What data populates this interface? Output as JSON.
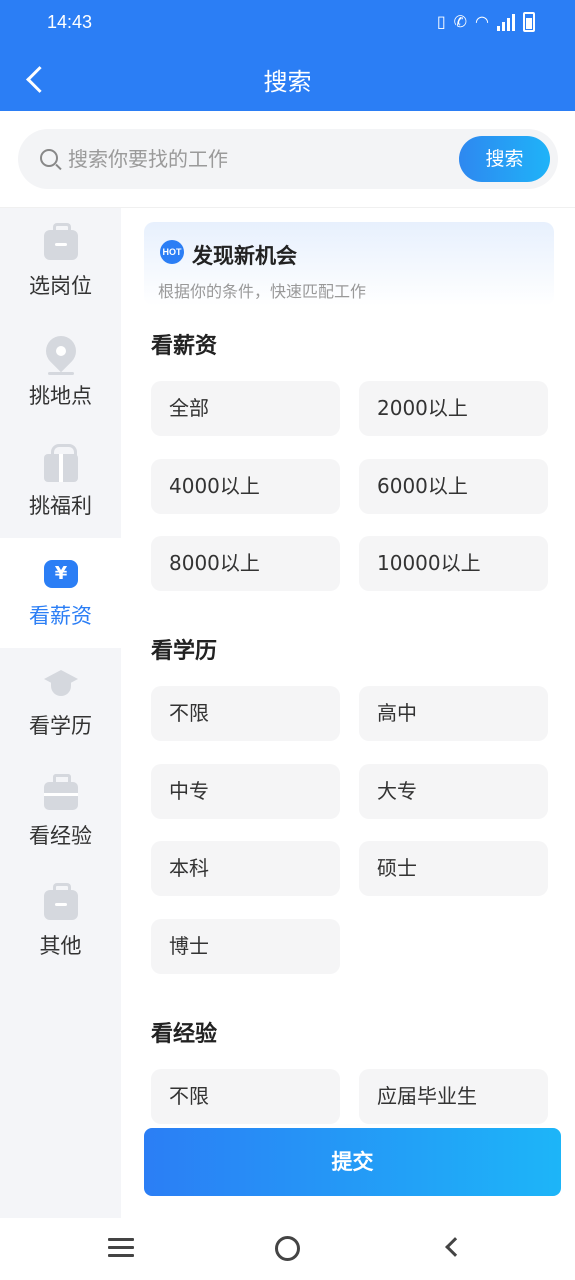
{
  "status_bar": {
    "time": "14:43"
  },
  "navbar": {
    "title": "搜索"
  },
  "search": {
    "placeholder": "搜索你要找的工作",
    "button": "搜索"
  },
  "sidebar": {
    "items": [
      {
        "label": "选岗位",
        "icon": "briefcase-icon",
        "active": false
      },
      {
        "label": "挑地点",
        "icon": "location-pin-icon",
        "active": false
      },
      {
        "label": "挑福利",
        "icon": "gift-icon",
        "active": false
      },
      {
        "label": "看薪资",
        "icon": "yen-icon",
        "active": true
      },
      {
        "label": "看学历",
        "icon": "graduation-cap-icon",
        "active": false
      },
      {
        "label": "看经验",
        "icon": "toolbox-icon",
        "active": false
      },
      {
        "label": "其他",
        "icon": "briefcase-icon",
        "active": false
      }
    ]
  },
  "promo": {
    "badge": "HOT",
    "title": "发现新机会",
    "subtitle": "根据你的条件，快速匹配工作"
  },
  "sections": {
    "salary": {
      "title": "看薪资",
      "options": [
        "全部",
        "2000以上",
        "4000以上",
        "6000以上",
        "8000以上",
        "10000以上"
      ]
    },
    "education": {
      "title": "看学历",
      "options": [
        "不限",
        "高中",
        "中专",
        "大专",
        "本科",
        "硕士",
        "博士"
      ]
    },
    "experience": {
      "title": "看经验",
      "options": [
        "不限",
        "应届毕业生"
      ]
    }
  },
  "submit": {
    "label": "提交"
  },
  "colors": {
    "primary": "#2b7ef5",
    "accent": "#1db5f8",
    "option_bg": "#f5f5f6",
    "sidebar_bg": "#f4f5f8"
  }
}
